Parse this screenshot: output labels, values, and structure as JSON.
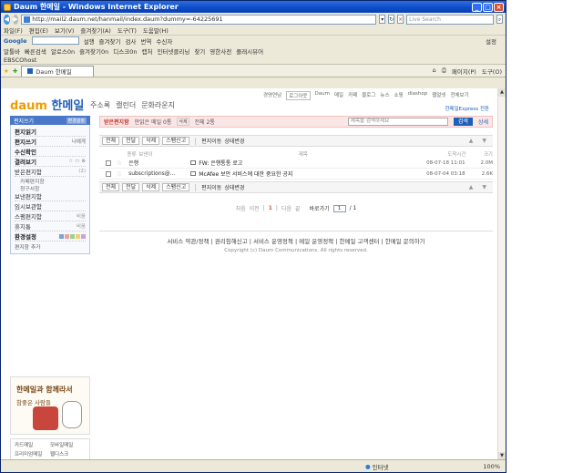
{
  "window": {
    "title": "Daum 한메일 - Windows Internet Explorer",
    "url": "http://mail2.daum.net/hanmail/index.daum?dummy=-64225691",
    "live_search": "Live Search"
  },
  "menubar": [
    "파일(F)",
    "편집(E)",
    "보기(V)",
    "즐겨찾기(A)",
    "도구(T)",
    "도움말(H)"
  ],
  "google_bar": {
    "label": "Google",
    "items": [
      "설행",
      "즐겨찾기",
      "검사",
      "번역",
      "수신자"
    ],
    "settings": "설정"
  },
  "links_bar": [
    "알툴바",
    "빠른검색",
    "알로스0n",
    "즐겨찾기0n",
    "디스크0n",
    "캡처",
    "인터넷클리닝",
    "찾기",
    "영한사전",
    "플래시뷰어"
  ],
  "links_bar2": "EBSCOhost",
  "ie_tab": {
    "label": "Daum 한메일",
    "right": [
      "페이지(P)",
      "도구(O)"
    ]
  },
  "daum": {
    "logo_daum": "daum",
    "logo_mail": "한메일",
    "nav": [
      "주소록",
      "캘린더",
      "문화라운지"
    ],
    "top_links": [
      "경영연남",
      "로그아웃",
      "Daum",
      "메일",
      "카페",
      "블로그",
      "뉴스",
      "쇼핑",
      "diashop",
      "웹얼넷",
      "전체보기"
    ],
    "express": "한메일Express 전환"
  },
  "sidebar": {
    "head_label": "편지쓰기",
    "head_btn": "환경설정",
    "items": [
      {
        "label": "편지읽기",
        "count": ""
      },
      {
        "label": "편지쓰기",
        "count": "나에게"
      },
      {
        "label": "수신확인",
        "count": ""
      },
      {
        "label": "결려보기",
        "count": ""
      },
      {
        "label": "받은편지함",
        "count": "(2)"
      }
    ],
    "sub_items": [
      "카페편지함",
      "청구서함"
    ],
    "items2": [
      {
        "label": "보낸편지함",
        "count": ""
      },
      {
        "label": "임시보관함",
        "count": ""
      },
      {
        "label": "스팸편지함",
        "count": "비움"
      },
      {
        "label": "휴지통",
        "count": "비움"
      },
      {
        "label": "환경설정",
        "count": ""
      }
    ],
    "add_folder": "편지함 추가",
    "promo_line1": "한메일과 함께라서",
    "promo_line2": "참좋은 사람들",
    "bottom_links": [
      "카드메일",
      "모바일메일",
      "프리미엄메일",
      "웹디스크"
    ]
  },
  "main": {
    "folder_title": "받은편지함",
    "unread_info": "안읽은 메일 0통",
    "delete_tag": "삭제",
    "total": "전체 2통",
    "search_placeholder": "제목을 검색하세요",
    "search_btn": "검색",
    "search_opt": "상세",
    "toolbar": [
      "전체",
      "전달",
      "삭제",
      "스팸신고",
      "편지이동",
      "상태변경"
    ],
    "columns": [
      "종류",
      "보낸이",
      "제목",
      "도착시간",
      "크기"
    ],
    "rows": [
      {
        "sender": "은행",
        "subject": "FW: 은행통통 로고",
        "date": "08-07-18 11:01",
        "size": "2.0M"
      },
      {
        "sender": "subscriptions@...",
        "subject": "McAfee 보안 서비스에 대한 중요한 공지",
        "date": "08-07-04 03:18",
        "size": "2.6K"
      }
    ],
    "pager": {
      "first": "처음",
      "prev": "이전",
      "current": "1",
      "next": "다음",
      "last": "끝",
      "go_label": "바로가기",
      "go_value": "1",
      "total_pages": "/ 1"
    },
    "footer_links": "서비스 약관/정책 | 권리침해신고 | 서비스 운영정책 | 메일 운영정책 | 한메일 고객센터 | 한메일 문의하기",
    "copyright": "Copyright (c) Daum Communications. All rights reserved."
  },
  "status": {
    "zone": "인터넷",
    "zoom": "100%"
  }
}
